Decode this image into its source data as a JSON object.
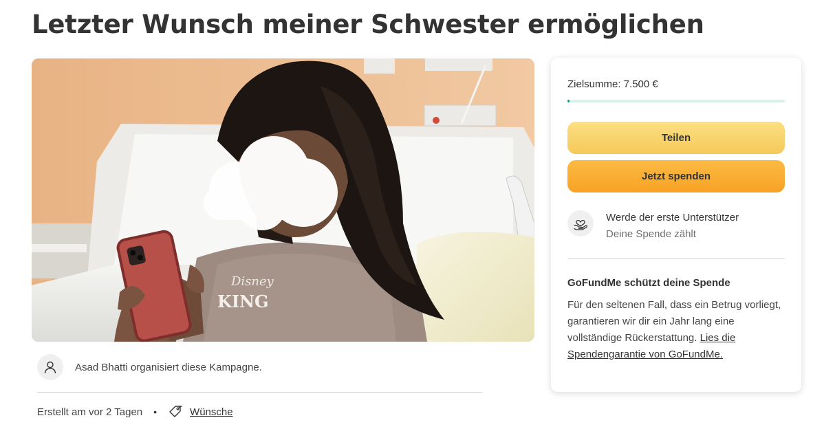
{
  "campaign": {
    "title": "Letzter Wunsch meiner Schwester ermöglichen"
  },
  "hero": {
    "shirt_text_top": "Disney",
    "shirt_text_bottom": "KING"
  },
  "organizer": {
    "icon": "user-icon",
    "text": "Asad Bhatti organisiert diese Kampagne."
  },
  "meta": {
    "created": "Erstellt am vor 2 Tagen",
    "separator": "•",
    "category_icon": "tag-icon",
    "category": "Wünsche"
  },
  "donation_card": {
    "goal": "Zielsumme: 7.500 €",
    "progress_fraction": 0.01,
    "share_label": "Teilen",
    "donate_label": "Jetzt spenden",
    "supporter_icon": "heart-hand-icon",
    "supporter_title": "Werde der erste Unterstützer",
    "supporter_sub": "Deine Spende zählt",
    "protection_title": "GoFundMe schützt deine Spende",
    "protection_text": "Für den seltenen Fall, dass ein Betrug vorliegt, garantieren wir dir ein Jahr lang eine vollständige Rückerstattung.",
    "protection_link": "Lies die Spendengarantie von GoFundMe."
  },
  "colors": {
    "accent_green": "#02a95c",
    "share_yellow": "#f5c859",
    "donate_orange": "#f7a225"
  }
}
